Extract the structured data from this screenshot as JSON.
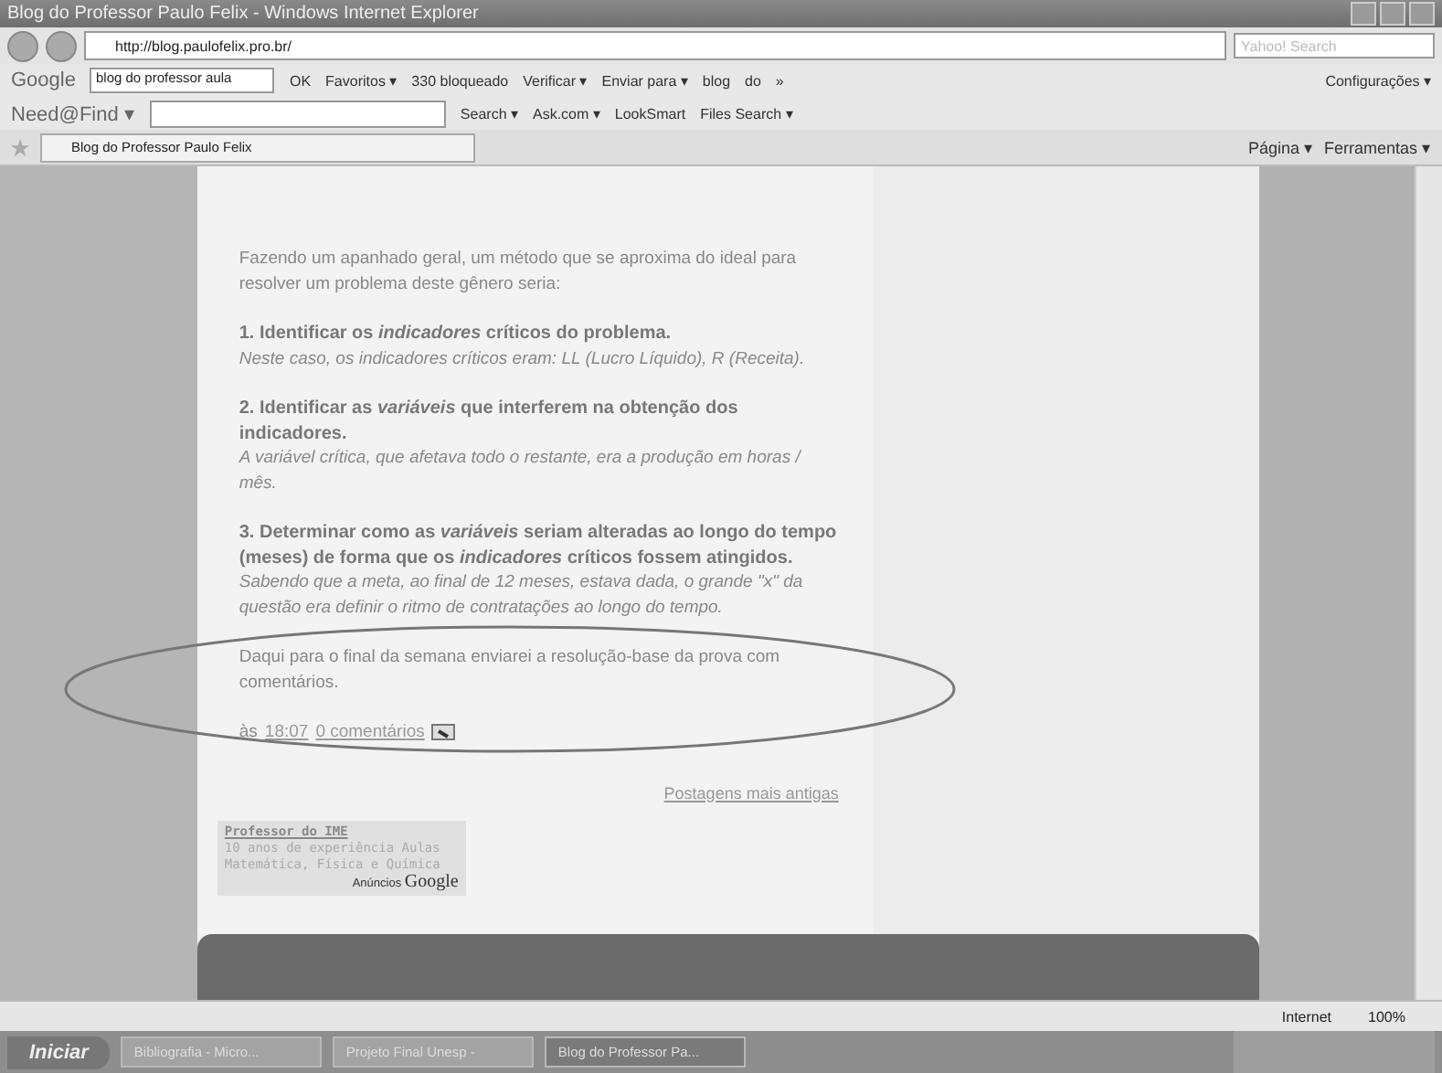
{
  "window": {
    "title": "Blog do Professor Paulo Felix - Windows Internet Explorer"
  },
  "address_bar": {
    "url": "http://blog.paulofelix.pro.br/",
    "search_placeholder": "Yahoo! Search"
  },
  "google_toolbar": {
    "logo": "Google",
    "query": "blog do professor aula",
    "items": [
      "OK",
      "Favoritos ▾",
      "330 bloqueado",
      "Verificar ▾",
      "Enviar para ▾",
      "blog",
      "do",
      "»"
    ],
    "settings": "Configurações ▾"
  },
  "needfind_toolbar": {
    "logo": "Need@Find ▾",
    "items": [
      "Search ▾",
      "Ask.com ▾",
      "LookSmart",
      "Files Search ▾"
    ]
  },
  "tab": {
    "label": "Blog do Professor Paulo Felix"
  },
  "command_bar": [
    "Página ▾",
    "Ferramentas ▾"
  ],
  "post": {
    "intro": "Fazendo um apanhado geral, um método que se aproxima do ideal para resolver um problema deste gênero seria:",
    "steps": [
      {
        "heading": "1. Identificar os *indicadores* críticos do problema.",
        "note": "Neste caso, os indicadores críticos eram: LL (Lucro Líquido), R (Receita)."
      },
      {
        "heading": "2. Identificar as *variáveis* que interferem na obtenção dos indicadores.",
        "note": "A variável crítica, que afetava todo o restante, era a produção em horas / mês."
      },
      {
        "heading": "3. Determinar como as *variáveis* seriam alteradas ao longo do tempo (meses) de forma que os *indicadores* críticos fossem atingidos.",
        "note": "Sabendo que a meta, ao final de 12 meses, estava dada, o grande \"x\" da questão era definir o ritmo de contratações ao longo do tempo."
      }
    ],
    "closing": "Daqui para o final da semana enviarei a resolução-base da prova com comentários.",
    "prefix": "às",
    "time": "18:07",
    "comments": "0 comentários"
  },
  "older_posts": "Postagens mais antigas",
  "ad": {
    "title": "Professor do IME",
    "lines": [
      "10 anos de experiência Aulas",
      "Matemática, Física e Química"
    ],
    "label": "Anúncios",
    "brand": "Google"
  },
  "status_bar": {
    "zone": "Internet",
    "zoom": "100%"
  },
  "taskbar": {
    "start": "Iniciar",
    "tasks": [
      {
        "label": "Bibliografia - Micro...",
        "selected": false
      },
      {
        "label": "Projeto Final Unesp -",
        "selected": false
      },
      {
        "label": "Blog do Professor Pa...",
        "selected": true
      }
    ]
  }
}
